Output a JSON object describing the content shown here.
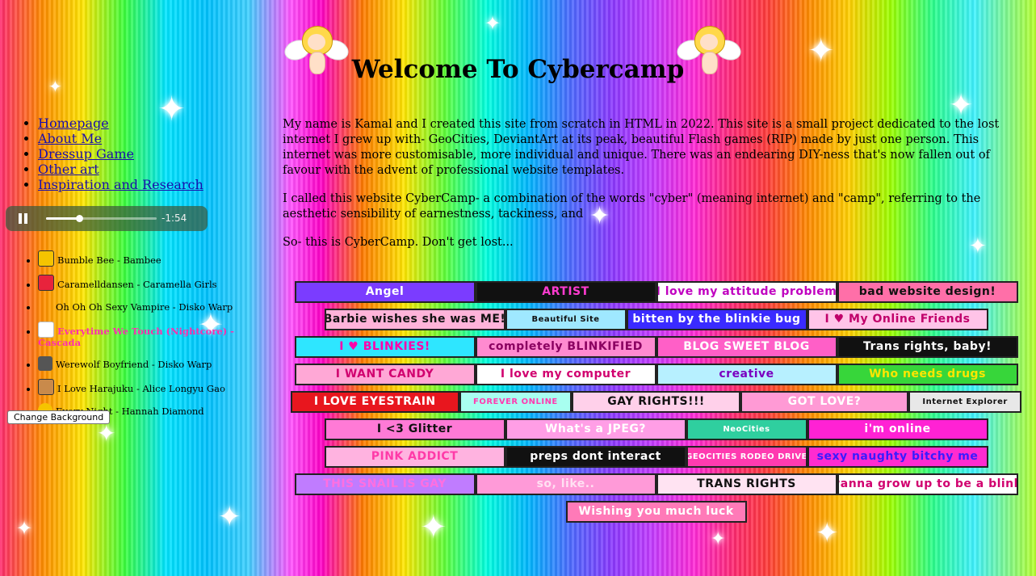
{
  "page": {
    "title": "Welcome To Cybercamp",
    "background_button_label": "Change Background"
  },
  "nav": {
    "items": [
      {
        "label": "Homepage"
      },
      {
        "label": "About Me"
      },
      {
        "label": "Dressup Game"
      },
      {
        "label": "Other art"
      },
      {
        "label": "Inspiration and Research"
      }
    ]
  },
  "player": {
    "state": "playing",
    "remaining_time": "-1:54",
    "progress_fraction": 0.3
  },
  "playlist": [
    {
      "title": "Bumble Bee - Bambee",
      "icon": "bee-icon",
      "color": "#f5c400"
    },
    {
      "title": "Caramelldansen - Caramella Girls",
      "icon": "heart-icon",
      "color": "#e8233c"
    },
    {
      "title": "Oh Oh Oh Sexy Vampire - Disko Warp",
      "icon": "",
      "color": ""
    },
    {
      "title": "Everytime We Touch (Nightcore) - Cascada",
      "icon": "sparkle-icon",
      "color": "#ff2fae",
      "active": true
    },
    {
      "title": "Werewolf Boyfriend - Disko Warp",
      "icon": "wolf-icon",
      "color": "#555555"
    },
    {
      "title": "I Love Harajuku - Alice Longyu Gao",
      "icon": "bear-icon",
      "color": "#c98a4b"
    },
    {
      "title": "Every Night - Hannah Diamond",
      "icon": "moon-icon",
      "color": "#f5c400"
    }
  ],
  "intro": {
    "paragraphs": [
      "My name is Kamal and I created this site from scratch in HTML in 2022. This site is a small project dedicated to the lost internet I grew up with- GeoCities, DeviantArt at its peak, beautiful Flash games (RIP) made by just one person. This internet was more customisable, more individual and unique. There was an endearing DIY-ness that's now fallen out of favour with the advent of professional website templates.",
      "I called this website CyberCamp- a combination of the words \"cyber\" (meaning internet) and \"camp\", referring to the aesthetic sensibility of earnestness, tackiness, and",
      "So- this is CyberCamp. Don't get lost..."
    ]
  },
  "blinkies": {
    "rows": [
      [
        {
          "text": "Angel",
          "bg": "#7b3cff",
          "fg": "#ffffff"
        },
        {
          "text": "ARTIST",
          "bg": "#111111",
          "fg": "#ff3bd0"
        },
        {
          "text": "I love my attitude problem",
          "bg": "#ffffff",
          "fg": "#c000c0"
        },
        {
          "text": "bad website design!",
          "bg": "#ff6fa8",
          "fg": "#111111"
        }
      ],
      [
        {
          "text": "Barbie wishes she was ME!",
          "bg": "#ffb3d9",
          "fg": "#111111"
        },
        {
          "text": "Beautiful Site",
          "bg": "#9fe8ff",
          "fg": "#111111",
          "small": true
        },
        {
          "text": "bitten by the blinkie bug",
          "bg": "#3a2bff",
          "fg": "#ffffff"
        },
        {
          "text": "I ♥ My Online Friends",
          "bg": "#ffc4e8",
          "fg": "#c0006a"
        }
      ],
      [
        {
          "text": "I ♥ BLINKIES!",
          "bg": "#2ee6ff",
          "fg": "#ff00aa"
        },
        {
          "text": "completely BLINKIFIED",
          "bg": "#ff8ad0",
          "fg": "#8a0060"
        },
        {
          "text": "BLOG SWEET BLOG",
          "bg": "#ff5fc7",
          "fg": "#ffffff"
        },
        {
          "text": "Trans rights, baby!",
          "bg": "#111111",
          "fg": "#ffffff"
        }
      ],
      [
        {
          "text": "I WANT CANDY",
          "bg": "#ffa8d6",
          "fg": "#d1006f"
        },
        {
          "text": "I love my computer",
          "bg": "#ffffff",
          "fg": "#d1006f"
        },
        {
          "text": "creative",
          "bg": "#b7f0ff",
          "fg": "#7a00c0"
        },
        {
          "text": "Who needs drugs",
          "bg": "#37d63a",
          "fg": "#ffe600"
        }
      ],
      [
        {
          "text": "I LOVE EYESTRAIN",
          "bg": "#e8161e",
          "fg": "#ffffff"
        },
        {
          "text": "FOREVER ONLINE",
          "bg": "#a8fff0",
          "fg": "#ff3bb0",
          "small": true
        },
        {
          "text": "GAY RIGHTS!!!",
          "bg": "#ffd0ea",
          "fg": "#111111"
        },
        {
          "text": "GOT LOVE?",
          "bg": "#ff9ad5",
          "fg": "#ffffff"
        },
        {
          "text": "Internet Explorer",
          "bg": "#e8e8e8",
          "fg": "#111111",
          "small": true
        }
      ],
      [
        {
          "text": "I <3 Glitter",
          "bg": "#ff7ad6",
          "fg": "#111111"
        },
        {
          "text": "What's a JPEG?",
          "bg": "#ff9ee6",
          "fg": "#ffffff"
        },
        {
          "text": "NeoCities",
          "bg": "#2fcf9f",
          "fg": "#ffffff",
          "small": true
        },
        {
          "text": "i'm online",
          "bg": "#ff22d4",
          "fg": "#ffffff"
        }
      ],
      [
        {
          "text": "PINK ADDICT",
          "bg": "#ffb3e0",
          "fg": "#ff3aa8"
        },
        {
          "text": "preps dont interact",
          "bg": "#111111",
          "fg": "#ffffff"
        },
        {
          "text": "GEOCITIES RODEO DRIVE",
          "bg": "#ff3bb0",
          "fg": "#ffffff",
          "small": true
        },
        {
          "text": "sexy naughty bitchy me",
          "bg": "#ff2bd0",
          "fg": "#3a1bff"
        }
      ],
      [
        {
          "text": "THIS SNAIL IS GAY",
          "bg": "#c07cff",
          "fg": "#ff6fe0"
        },
        {
          "text": "so, like..",
          "bg": "#ff9ad8",
          "fg": "#ffe0f2"
        },
        {
          "text": "TRANS RIGHTS",
          "bg": "#ffe3f2",
          "fg": "#111111"
        },
        {
          "text": "I wanna grow up to be a blinkie",
          "bg": "#ffffff",
          "fg": "#d1006f"
        }
      ],
      [
        {
          "text": "Wishing you much luck",
          "bg": "#ff7ab8",
          "fg": "#ffffff"
        }
      ]
    ]
  }
}
